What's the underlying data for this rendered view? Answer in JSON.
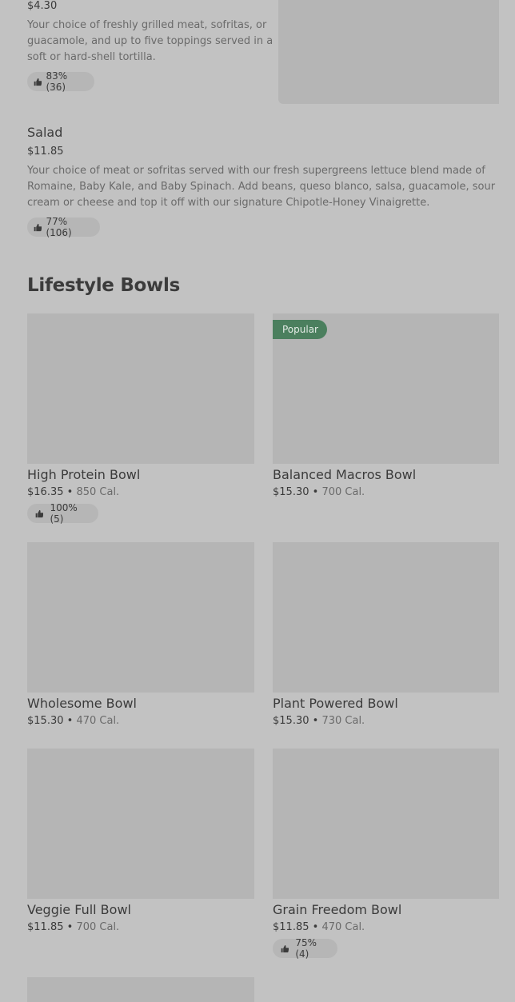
{
  "burrito_item": {
    "price": "$4.30",
    "description_lines": [
      "Your choice of freshly grilled meat, sofritas, or",
      "guacamole, and up to five toppings served in a",
      "soft or hard-shell tortilla."
    ],
    "rating": "83% (36)"
  },
  "salad_item": {
    "title": "Salad",
    "price": "$11.85",
    "description_lines": [
      "Your choice of meat or sofritas served with our fresh supergreens lettuce blend made of",
      "Romaine, Baby Kale, and Baby Spinach. Add beans, queso blanco, salsa, guacamole, sour",
      "cream or cheese and top it off with our signature Chipotle-Honey Vinaigrette."
    ],
    "rating": "77% (106)"
  },
  "lifestyle_section": {
    "title": "Lifestyle Bowls",
    "items": [
      {
        "title": "High Protein Bowl",
        "price": "$16.35",
        "sep": "•",
        "calories": "850 Cal.",
        "rating": "100% (5)"
      },
      {
        "title": "Balanced Macros Bowl",
        "price": "$15.30",
        "sep": "•",
        "calories": "700 Cal.",
        "tag": "Popular"
      },
      {
        "title": "Wholesome Bowl",
        "price": "$15.30",
        "sep": "•",
        "calories": "470 Cal."
      },
      {
        "title": "Plant Powered Bowl",
        "price": "$15.30",
        "sep": "•",
        "calories": "730 Cal."
      },
      {
        "title": "Veggie Full Bowl",
        "price": "$11.85",
        "sep": "•",
        "calories": "700 Cal."
      },
      {
        "title": "Grain Freedom Bowl",
        "price": "$11.85",
        "sep": "•",
        "calories": "470 Cal.",
        "rating": "75% (4)"
      }
    ]
  },
  "icons": {
    "rating": "thumbs-up-icon"
  }
}
